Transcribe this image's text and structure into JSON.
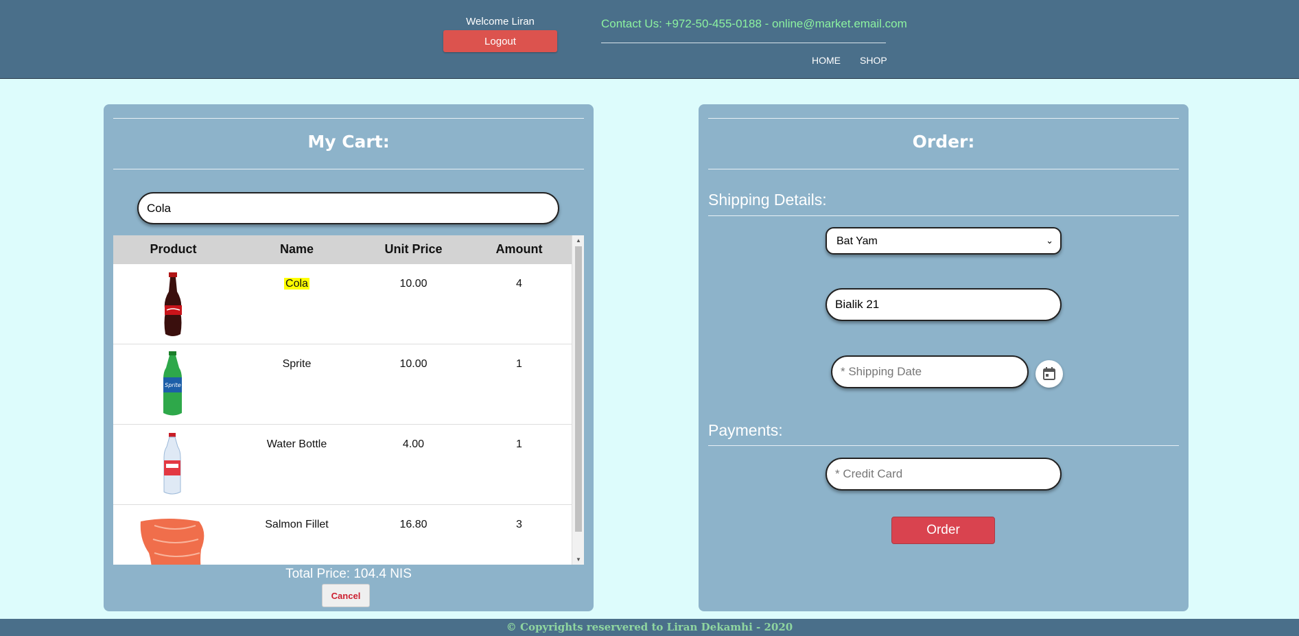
{
  "header": {
    "welcome": "Welcome Liran",
    "logout_label": "Logout",
    "contact": "Contact Us: +972-50-455-0188 - online@market.email.com",
    "nav": [
      "HOME",
      "SHOP"
    ]
  },
  "cart": {
    "title": "My Cart:",
    "search_value": "Cola",
    "columns": [
      "Product",
      "Name",
      "Unit Price",
      "Amount"
    ],
    "rows": [
      {
        "name": "Cola",
        "price": "10.00",
        "amount": "4",
        "image": "cola-bottle"
      },
      {
        "name": "Sprite",
        "price": "10.00",
        "amount": "1",
        "image": "sprite-bottle"
      },
      {
        "name": "Water Bottle",
        "price": "4.00",
        "amount": "1",
        "image": "water-bottle"
      },
      {
        "name": "Salmon Fillet",
        "price": "16.80",
        "amount": "3",
        "image": "salmon-fillet"
      }
    ],
    "total": "Total Price: 104.4 NIS",
    "cancel_label": "Cancel"
  },
  "order": {
    "title": "Order:",
    "shipping_title": "Shipping Details:",
    "city_value": "Bat Yam",
    "street_value": "Bialik 21",
    "date_placeholder": "* Shipping Date",
    "payments_title": "Payments:",
    "card_placeholder": "* Credit Card",
    "order_label": "Order"
  },
  "footer": {
    "text": "© Copyrights reservered to Liran Dekamhi - 2020"
  },
  "colors": {
    "header": "#4a6f8a",
    "panel": "#8db3ca",
    "background": "#ddfcfc",
    "logout": "#dc534e",
    "order": "#d9434f",
    "contact": "#8cf2a0"
  }
}
